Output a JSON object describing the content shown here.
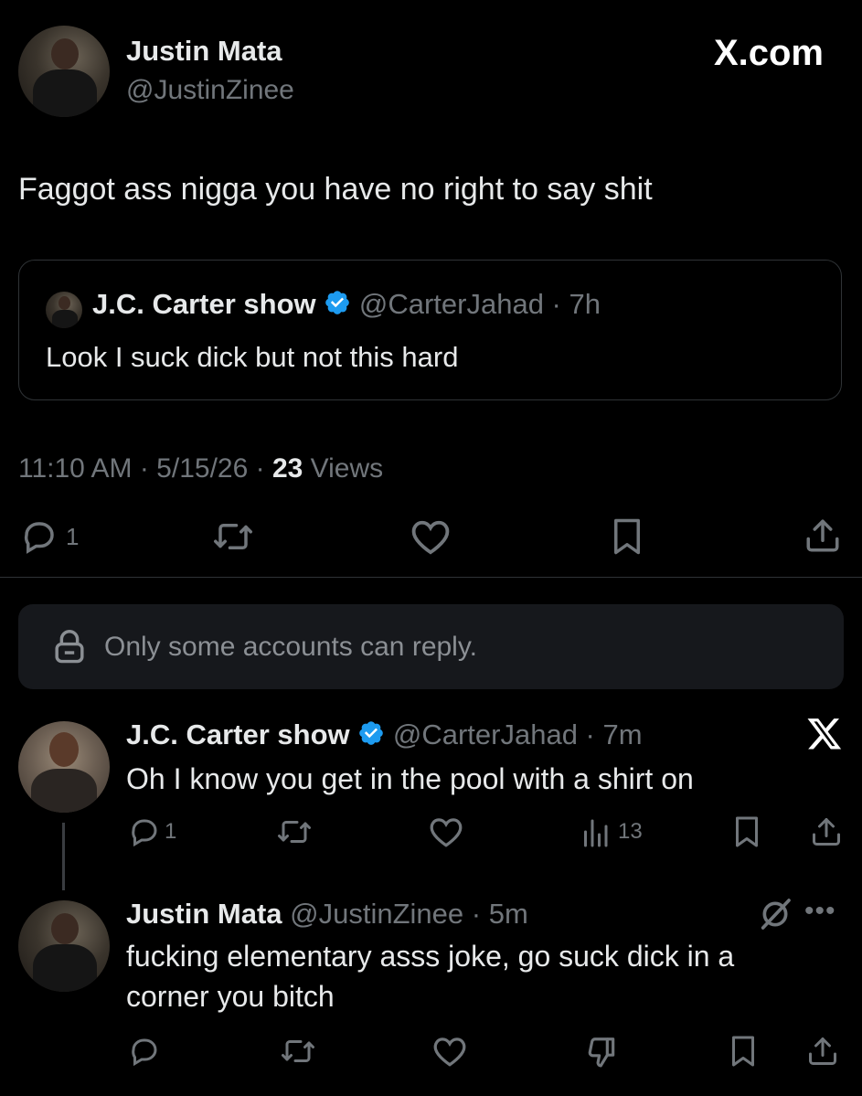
{
  "main_post": {
    "author_name": "Justin Mata",
    "author_handle": "@JustinZinee",
    "brand": "X.com",
    "text": "Faggot ass nigga you have no right to say shit",
    "quoted": {
      "author_name": "J.C. Carter show",
      "author_handle": "@CarterJahad",
      "time": "7h",
      "text": "Look I suck dick but not this hard"
    },
    "timestamp": "11:10 AM · 5/15/26 · ",
    "views_count": "23",
    "views_label": " Views",
    "reply_count": "1"
  },
  "notice": {
    "text": "Only some accounts can reply."
  },
  "reply1": {
    "author_name": "J.C. Carter show",
    "author_handle": "@CarterJahad",
    "time": "7m",
    "text": "Oh I know you get in the pool with a shirt on",
    "reply_count": "1",
    "views_count": "13"
  },
  "reply2": {
    "author_name": "Justin Mata",
    "author_handle": "@JustinZinee",
    "time": "5m",
    "text_line1": "fucking elementary asss joke, go suck dick in a",
    "text_line2": "corner you bitch"
  },
  "colors": {
    "background": "#000000",
    "text": "#e7e9ea",
    "muted": "#71767b",
    "verified": "#1d9bf0",
    "divider": "#2f3336",
    "notice_bg": "#16181c"
  }
}
